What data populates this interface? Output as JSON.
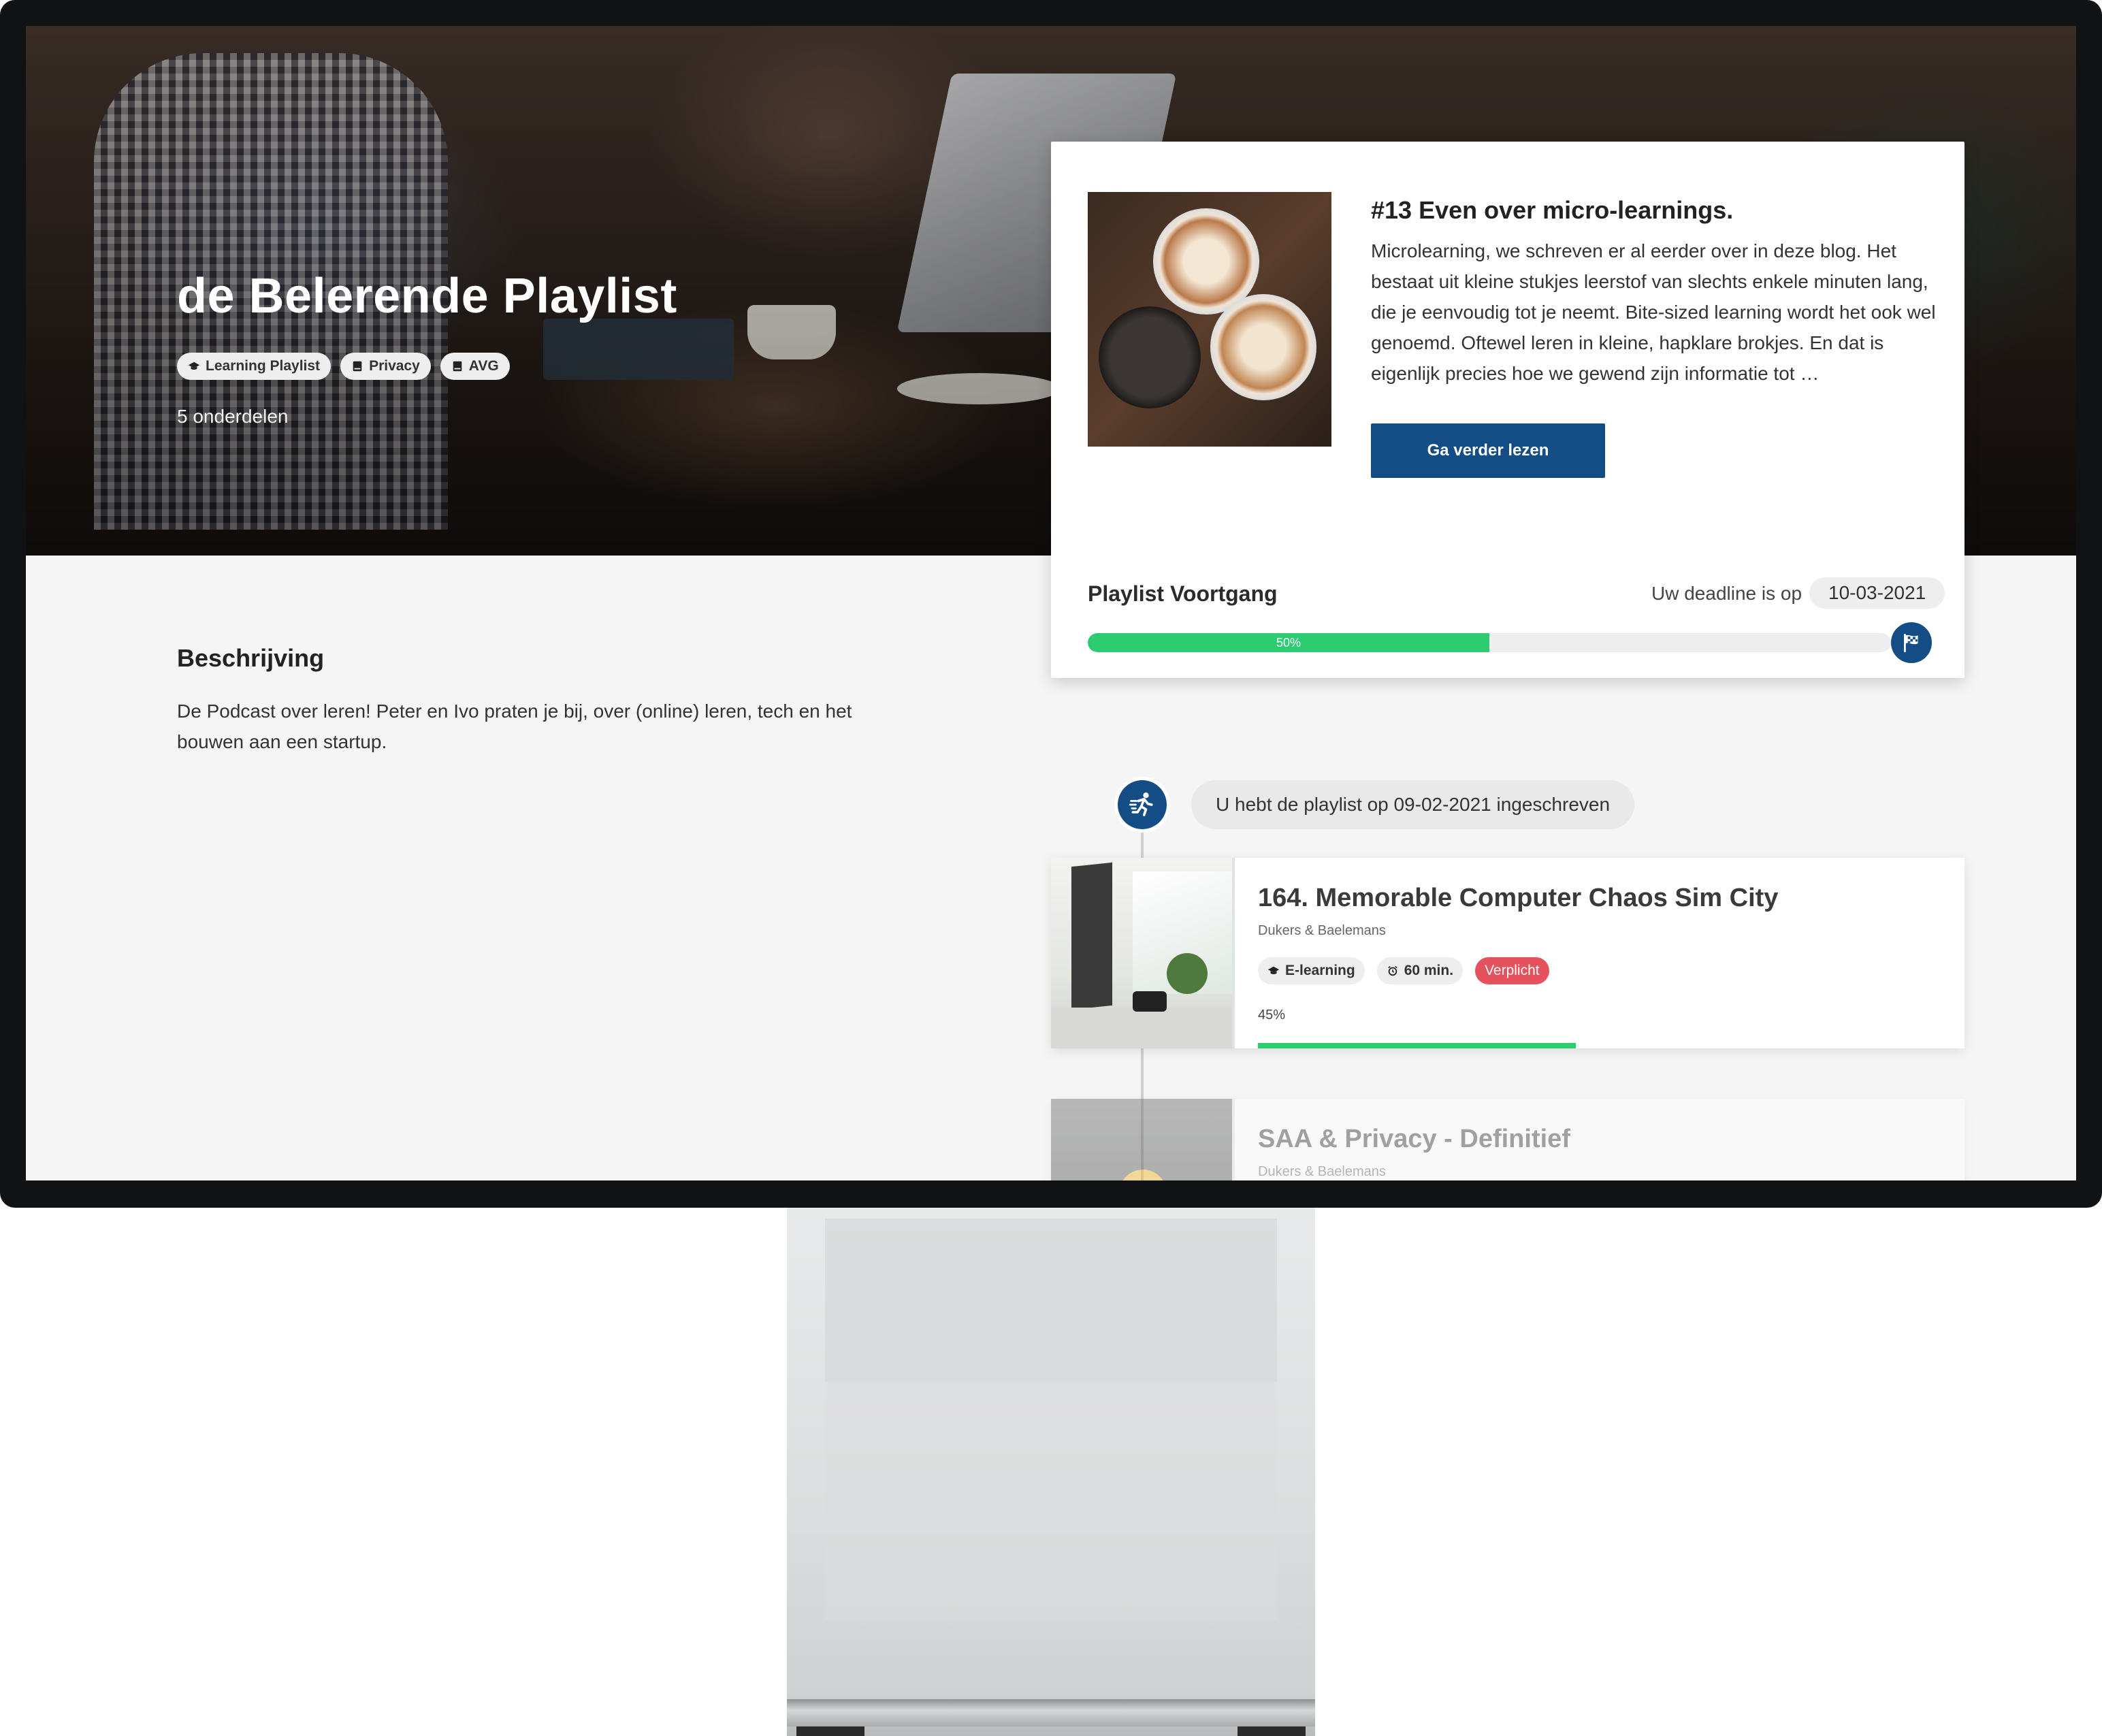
{
  "hero": {
    "title": "de Belerende Playlist",
    "tags": [
      {
        "label": "Learning Playlist",
        "icon": "graduation-cap-icon"
      },
      {
        "label": "Privacy",
        "icon": "book-icon"
      },
      {
        "label": "AVG",
        "icon": "book-icon"
      }
    ],
    "count": "5 onderdelen"
  },
  "blog": {
    "title": "#13 Even over micro-learnings.",
    "text": "Microlearning, we schreven er al eerder over in deze blog. Het bestaat uit kleine stukjes leerstof van slechts enkele minuten lang, die je eenvoudig tot je neemt. Bite-sized learning wordt het ook wel genoemd. Oftewel leren in kleine, hapklare brokjes. En dat is eigenlijk precies hoe we gewend zijn informatie tot …",
    "button": "Ga verder lezen"
  },
  "progress": {
    "title": "Playlist Voortgang",
    "deadline_label": "Uw deadline is op",
    "deadline_date": "10-03-2021",
    "percent": 50,
    "percent_label": "50%",
    "finish_icon": "checkered-flag-icon"
  },
  "description": {
    "title": "Beschrijving",
    "text": "De Podcast over leren! Peter en Ivo praten je bij, over (online) leren, tech en het bouwen aan een startup."
  },
  "timeline": {
    "enrolled_icon": "running-person-icon",
    "enrolled_text": "U hebt de playlist op 09-02-2021 ingeschreven",
    "items": [
      {
        "title": "164. Memorable Computer Chaos Sim City",
        "subtitle": "Dukers & Baelemans",
        "type": "E-learning",
        "duration": "60 min.",
        "required": "Verplicht",
        "progress": 45,
        "progress_label": "45%"
      },
      {
        "title": "SAA & Privacy - Definitief",
        "subtitle": "Dukers & Baelemans"
      }
    ]
  },
  "colors": {
    "primary": "#144d86",
    "progress": "#2ecc71",
    "required": "#e5515c",
    "background": "#f5f5f5"
  }
}
